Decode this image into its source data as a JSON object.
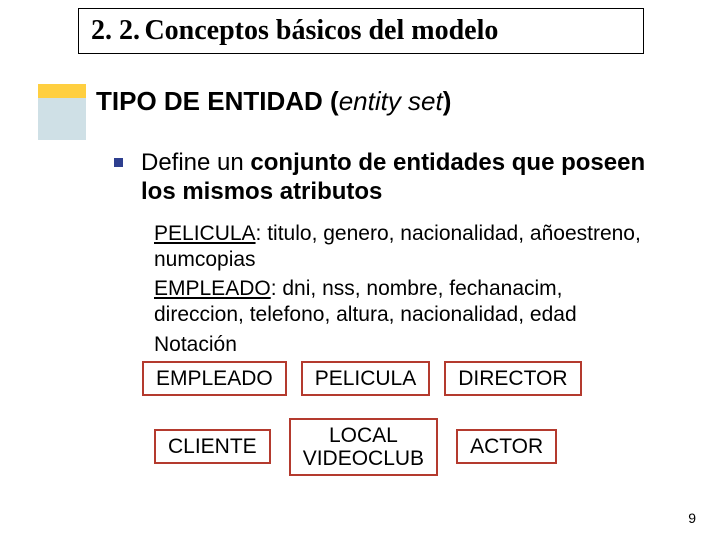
{
  "colors": {
    "accentTop": "#ffcf40",
    "accentBottom": "#cfe0e6",
    "bullet": "#2e3f8f",
    "boxBorder": "#b43a2e"
  },
  "section": {
    "number": "2. 2.",
    "title": "Conceptos básicos del modelo"
  },
  "subtitle": {
    "plain": "TIPO DE ENTIDAD ",
    "paren_open": "(",
    "italic": "entity set",
    "paren_close": ")"
  },
  "definition": {
    "lead": "Define un ",
    "strong": "conjunto de entidades que poseen los mismos atributos"
  },
  "examples": [
    {
      "name": "PELICULA",
      "attrs": "titulo, genero, nacionalidad, añoestreno, numcopias"
    },
    {
      "name": "EMPLEADO",
      "attrs": "dni, nss, nombre, fechanacim, direccion, telefono, altura, nacionalidad, edad"
    }
  ],
  "notation_label": "Notación",
  "entity_boxes_row1": [
    "EMPLEADO",
    "PELICULA",
    "DIRECTOR"
  ],
  "entity_boxes_row2": [
    "CLIENTE",
    "LOCAL\nVIDEOCLUB",
    "ACTOR"
  ],
  "page_number": "9"
}
